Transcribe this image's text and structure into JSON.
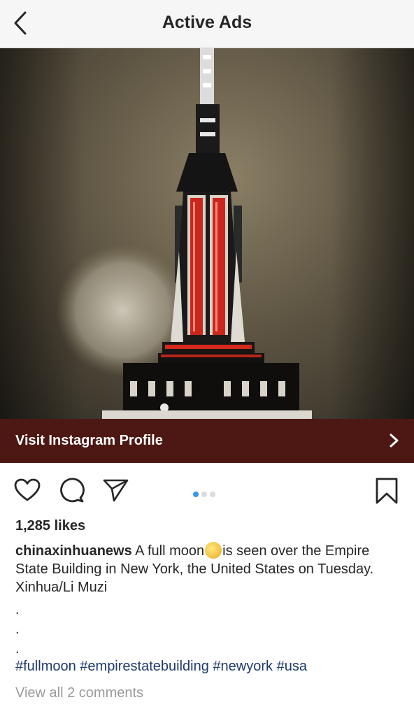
{
  "header": {
    "title": "Active Ads",
    "back_icon": "chevron-left-icon"
  },
  "post": {
    "image_alt": "Empire State Building lit red with a full moon",
    "cta": {
      "label": "Visit Instagram Profile",
      "icon": "chevron-right-icon"
    },
    "actions": {
      "icons": [
        "heart-icon",
        "comment-icon",
        "share-icon",
        "bookmark-icon"
      ],
      "carousel_total": 3,
      "carousel_active": 1
    },
    "likes": "1,285 likes",
    "caption": {
      "username": "chinaxinhuanews",
      "text_before": " A full moon",
      "emoji": "full-moon-emoji",
      "text_after": "is seen over the Empire State Building in New York, the United States on Tuesday. Xinhua/Li Muzi"
    },
    "separator_dots": [
      ".",
      ".",
      "."
    ],
    "hashtags": [
      "#fullmoon",
      "#empirestatebuilding",
      "#newyork",
      "#usa"
    ],
    "view_comments": "View all 2 comments"
  },
  "colors": {
    "cta_background": "#4d1814",
    "hashtag": "#1e3a6d",
    "carousel_active": "#3897f0",
    "carousel_inactive": "#dbdbdb",
    "muted_text": "#9a9a9a"
  }
}
